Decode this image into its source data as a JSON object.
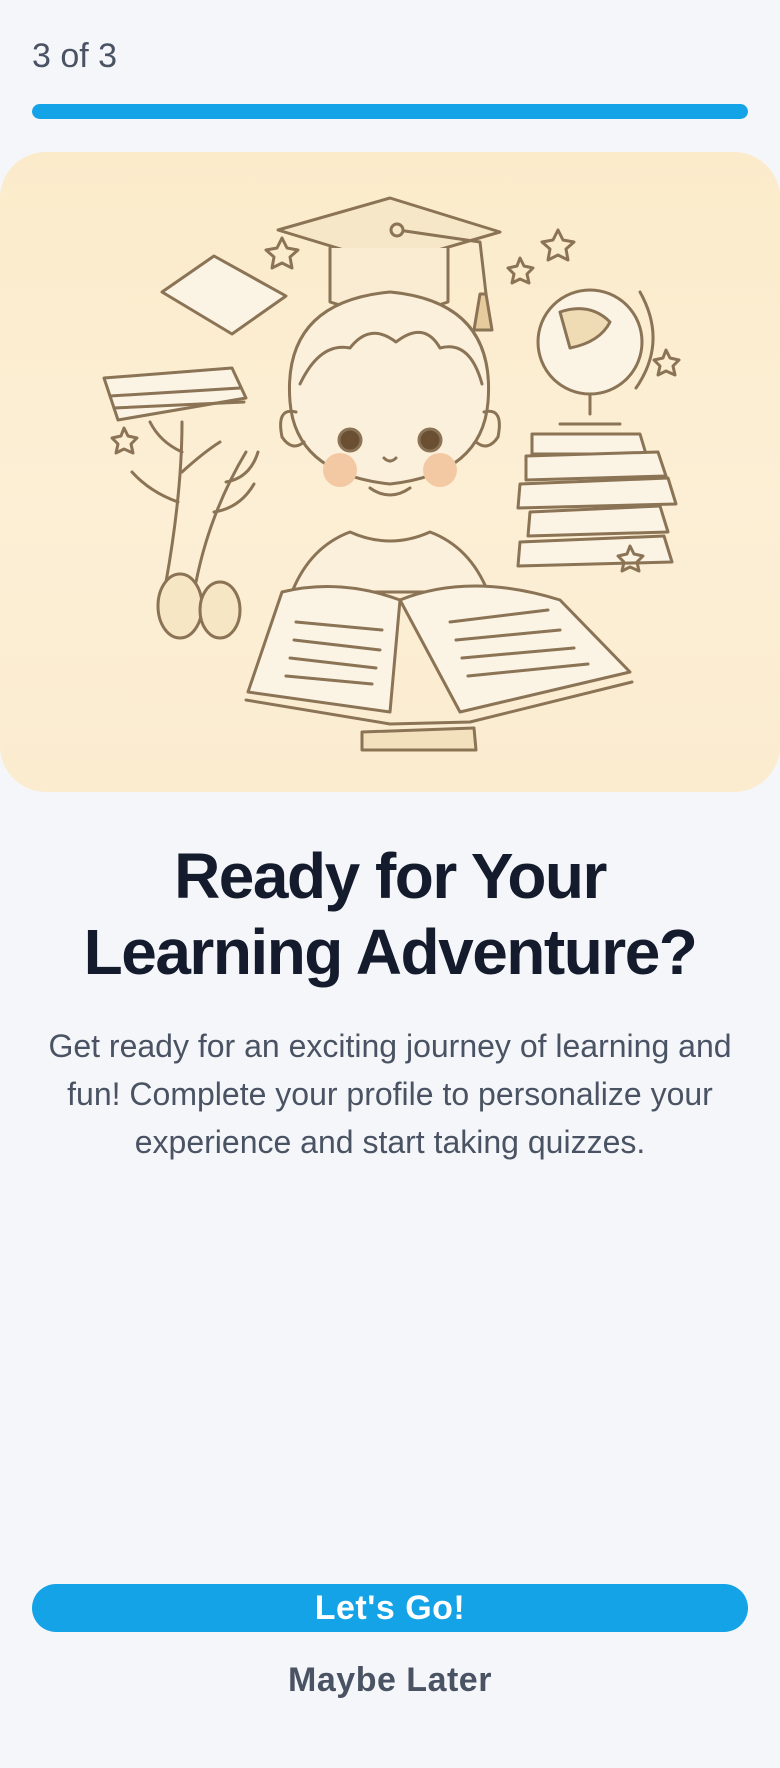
{
  "header": {
    "step_label": "3 of 3",
    "progress_fraction": 1.0
  },
  "hero": {
    "illustration": "child-with-books-graduation-cap-globe-illustration"
  },
  "content": {
    "title": "Ready for Your Learning Adventure?",
    "description": "Get ready for an exciting journey of learning and fun! Complete your profile to personalize your experience and start taking quizzes."
  },
  "actions": {
    "primary_label": "Let's Go!",
    "secondary_label": "Maybe Later"
  },
  "colors": {
    "accent": "#14a3e6",
    "background": "#f5f6f9",
    "title": "#141b2d",
    "body_text": "#4a5363",
    "hero_background": "#fcefd5"
  }
}
